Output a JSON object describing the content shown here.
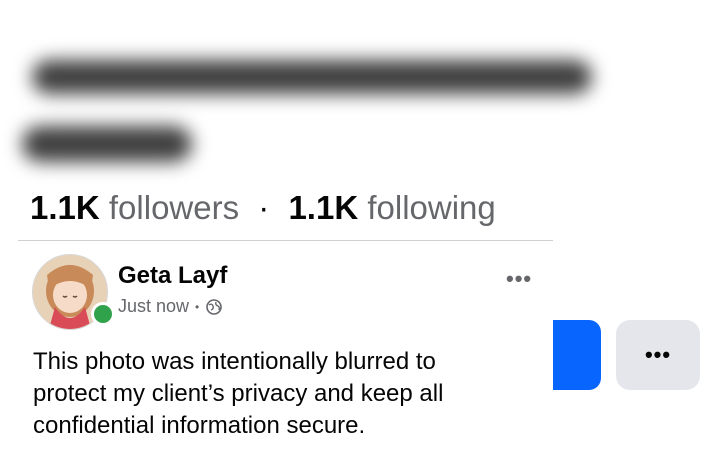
{
  "profile": {
    "followers_count": "1.1K",
    "followers_label": "followers",
    "separator": "·",
    "following_count": "1.1K",
    "following_label": "following"
  },
  "post": {
    "author": "Geta Layf",
    "timestamp": "Just now",
    "meta_separator": "•",
    "privacy_icon": "globe-icon",
    "more_icon": "more-horizontal-icon",
    "text": "This photo was intentionally blurred to protect my client’s privacy and keep all confidential information secure."
  },
  "actions": {
    "more_label": "•••"
  },
  "colors": {
    "primary": "#0866ff",
    "secondary_bg": "#e4e6eb",
    "online": "#31a24c",
    "muted_text": "#65676b"
  }
}
